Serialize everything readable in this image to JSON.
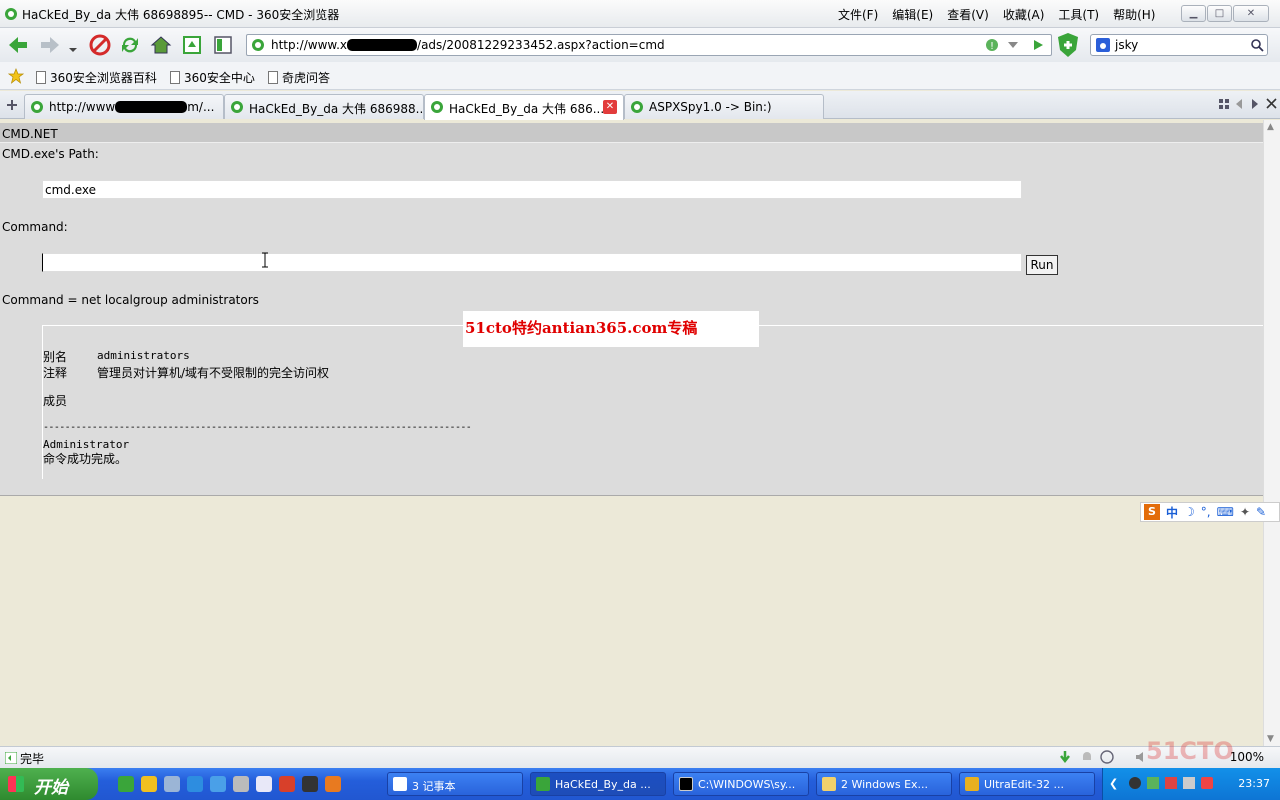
{
  "window": {
    "title": "HaCkEd_By_da 大伟 68698895-- CMD - 360安全浏览器",
    "menu": [
      "文件(F)",
      "编辑(E)",
      "查看(V)",
      "收藏(A)",
      "工具(T)",
      "帮助(H)"
    ]
  },
  "address": {
    "url_prefix": "http://www.x",
    "url_suffix": "/ads/20081229233452.aspx?action=cmd"
  },
  "search": {
    "value": "jsky"
  },
  "favorites": [
    "360安全浏览器百科",
    "360安全中心",
    "奇虎问答"
  ],
  "tabs": [
    {
      "label_prefix": "http://www",
      "label_suffix": "m/..."
    },
    {
      "label": "HaCkEd_By_da 大伟 686988..."
    },
    {
      "label": "HaCkEd_By_da 大伟 686..."
    },
    {
      "label": "ASPXSpy1.0 -> Bin:)"
    }
  ],
  "page": {
    "header": "CMD.NET",
    "path_label": "CMD.exe's Path:",
    "path_value": "cmd.exe",
    "command_label": "Command:",
    "command_value": "",
    "run_label": "Run",
    "command_echo": "Command = net localgroup administrators",
    "output": {
      "alias_key": "别名",
      "alias_val": "administrators",
      "comment_key": "注释",
      "comment_val": "管理员对计算机/域有不受限制的完全访问权",
      "members_key": "成员",
      "separator": "-------------------------------------------------------------------------------",
      "member": "Administrator",
      "done": "命令成功完成。"
    },
    "watermark": "51cto特约antian365.com专稿"
  },
  "ime": {
    "label": "中",
    "extra": "°,"
  },
  "statusbar": {
    "text": "完毕",
    "zoom": "100%",
    "watermark": "51CTO"
  },
  "taskbar": {
    "start": "开始",
    "tasks": [
      "3 记事本",
      "HaCkEd_By_da ...",
      "C:\\WINDOWS\\sy...",
      "2 Windows Ex...",
      "UltraEdit-32 ..."
    ],
    "clock": "23:37"
  }
}
